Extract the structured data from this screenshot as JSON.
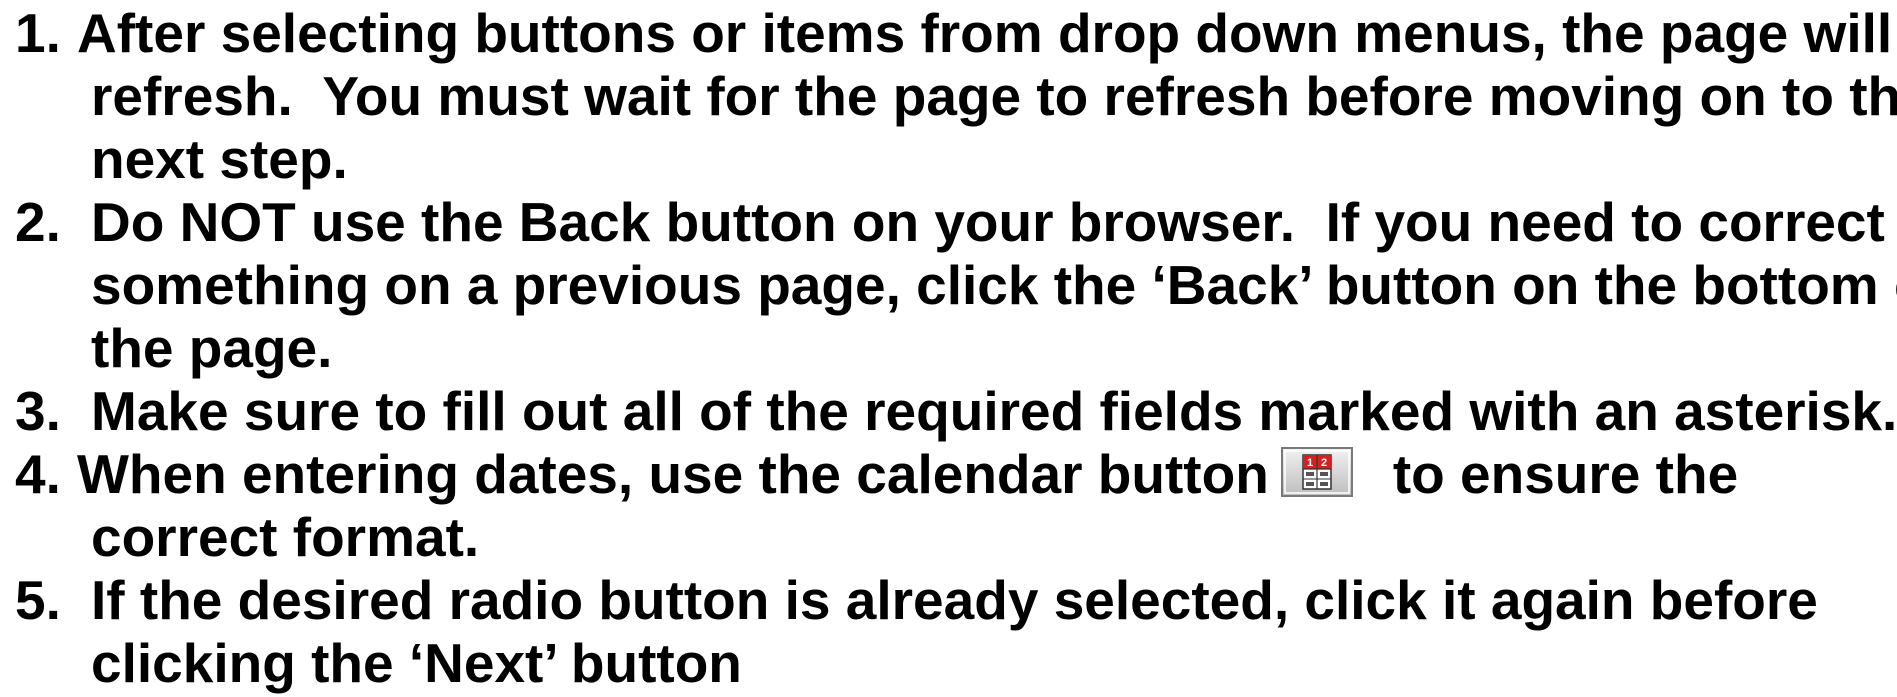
{
  "instructions": [
    {
      "number": "1.",
      "lines": [
        "After selecting buttons or items from drop down menus, the page will",
        "refresh.  You must wait for the page to refresh before moving on to the",
        "next step."
      ]
    },
    {
      "number": "2.",
      "lines": [
        "Do NOT use the Back button on your browser.  If you need to correct",
        "something on a previous page, click the ‘Back’ button on the bottom of",
        "the page."
      ]
    },
    {
      "number": "3.",
      "lines": [
        "Make sure to fill out all of the required fields marked with an asterisk."
      ]
    },
    {
      "number": "4.",
      "line1_before_icon": "When entering dates, use the calendar button",
      "line1_after_icon": "to ensure the",
      "lines_rest": [
        "correct format."
      ],
      "icon": "calendar-icon"
    },
    {
      "number": "5.",
      "lines": [
        "If the desired radio button is already selected, click it again before",
        "clicking the ‘Next’ button"
      ]
    }
  ]
}
